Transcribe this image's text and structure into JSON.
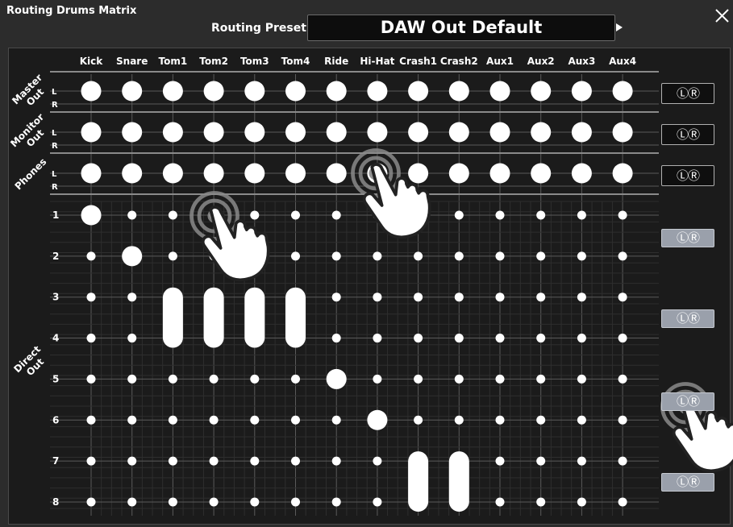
{
  "window": {
    "title": "Routing Drums Matrix",
    "close_icon": "close-icon"
  },
  "preset": {
    "label": "Routing Preset",
    "value": "DAW Out Default"
  },
  "columns": [
    "Kick",
    "Snare",
    "Tom1",
    "Tom2",
    "Tom3",
    "Tom4",
    "Ride",
    "Hi-Hat",
    "Crash1",
    "Crash2",
    "Aux1",
    "Aux2",
    "Aux3",
    "Aux4"
  ],
  "groups": [
    {
      "name": "Master Out",
      "lines": [
        "Master",
        "Out"
      ],
      "rows": [
        "L",
        "R"
      ]
    },
    {
      "name": "Monitor Out",
      "lines": [
        "Monitor",
        "Out"
      ],
      "rows": [
        "L",
        "R"
      ]
    },
    {
      "name": "Phones",
      "lines": [
        "Phones"
      ],
      "rows": [
        "L",
        "R"
      ]
    }
  ],
  "direct": {
    "name": "Direct Out",
    "lines": [
      "Direct",
      "Out"
    ],
    "rows": [
      "1",
      "2",
      "3",
      "4",
      "5",
      "6",
      "7",
      "8"
    ]
  },
  "lr_buttons": [
    "ⓁⓇ",
    "ⓁⓇ",
    "ⓁⓇ",
    "ⓁⓇ",
    "ⓁⓇ",
    "ⓁⓇ",
    "ⓁⓇ"
  ],
  "routing": {
    "stereo_groups_all_on": true,
    "direct_single": [
      {
        "column": "Kick",
        "row": "1"
      },
      {
        "column": "Snare",
        "row": "2"
      },
      {
        "column": "Ride",
        "row": "5"
      },
      {
        "column": "Hi-Hat",
        "row": "6"
      }
    ],
    "direct_pairs": [
      {
        "column": "Tom1",
        "rows": [
          "3",
          "4"
        ]
      },
      {
        "column": "Tom2",
        "rows": [
          "3",
          "4"
        ]
      },
      {
        "column": "Tom3",
        "rows": [
          "3",
          "4"
        ]
      },
      {
        "column": "Tom4",
        "rows": [
          "3",
          "4"
        ]
      },
      {
        "column": "Crash1",
        "rows": [
          "7",
          "8"
        ]
      },
      {
        "column": "Crash2",
        "rows": [
          "7",
          "8"
        ]
      }
    ]
  },
  "overlay_icons": [
    "tap-gesture-icon",
    "tap-gesture-icon",
    "tap-gesture-icon"
  ],
  "colors": {
    "background": "#2c2c2c",
    "panel": "#1b1b1b",
    "node": "#ffffff",
    "grid": "#555555",
    "lr_grey": "#9aa0ab"
  }
}
